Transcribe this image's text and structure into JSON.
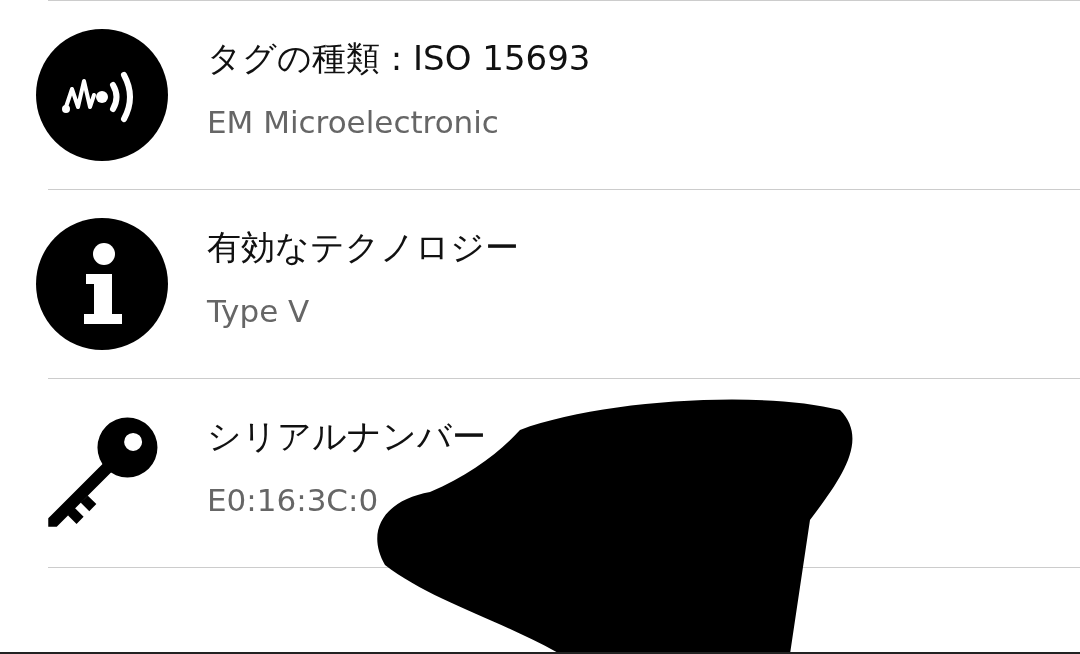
{
  "rows": [
    {
      "kind": "tag",
      "title": "タグの種類 : ISO 15693",
      "subtitle": "EM Microelectronic"
    },
    {
      "kind": "info",
      "title": "有効なテクノロジー",
      "subtitle": "Type V"
    },
    {
      "kind": "key",
      "title": "シリアルナンバー",
      "subtitle": "E0:16:3C:0"
    }
  ]
}
